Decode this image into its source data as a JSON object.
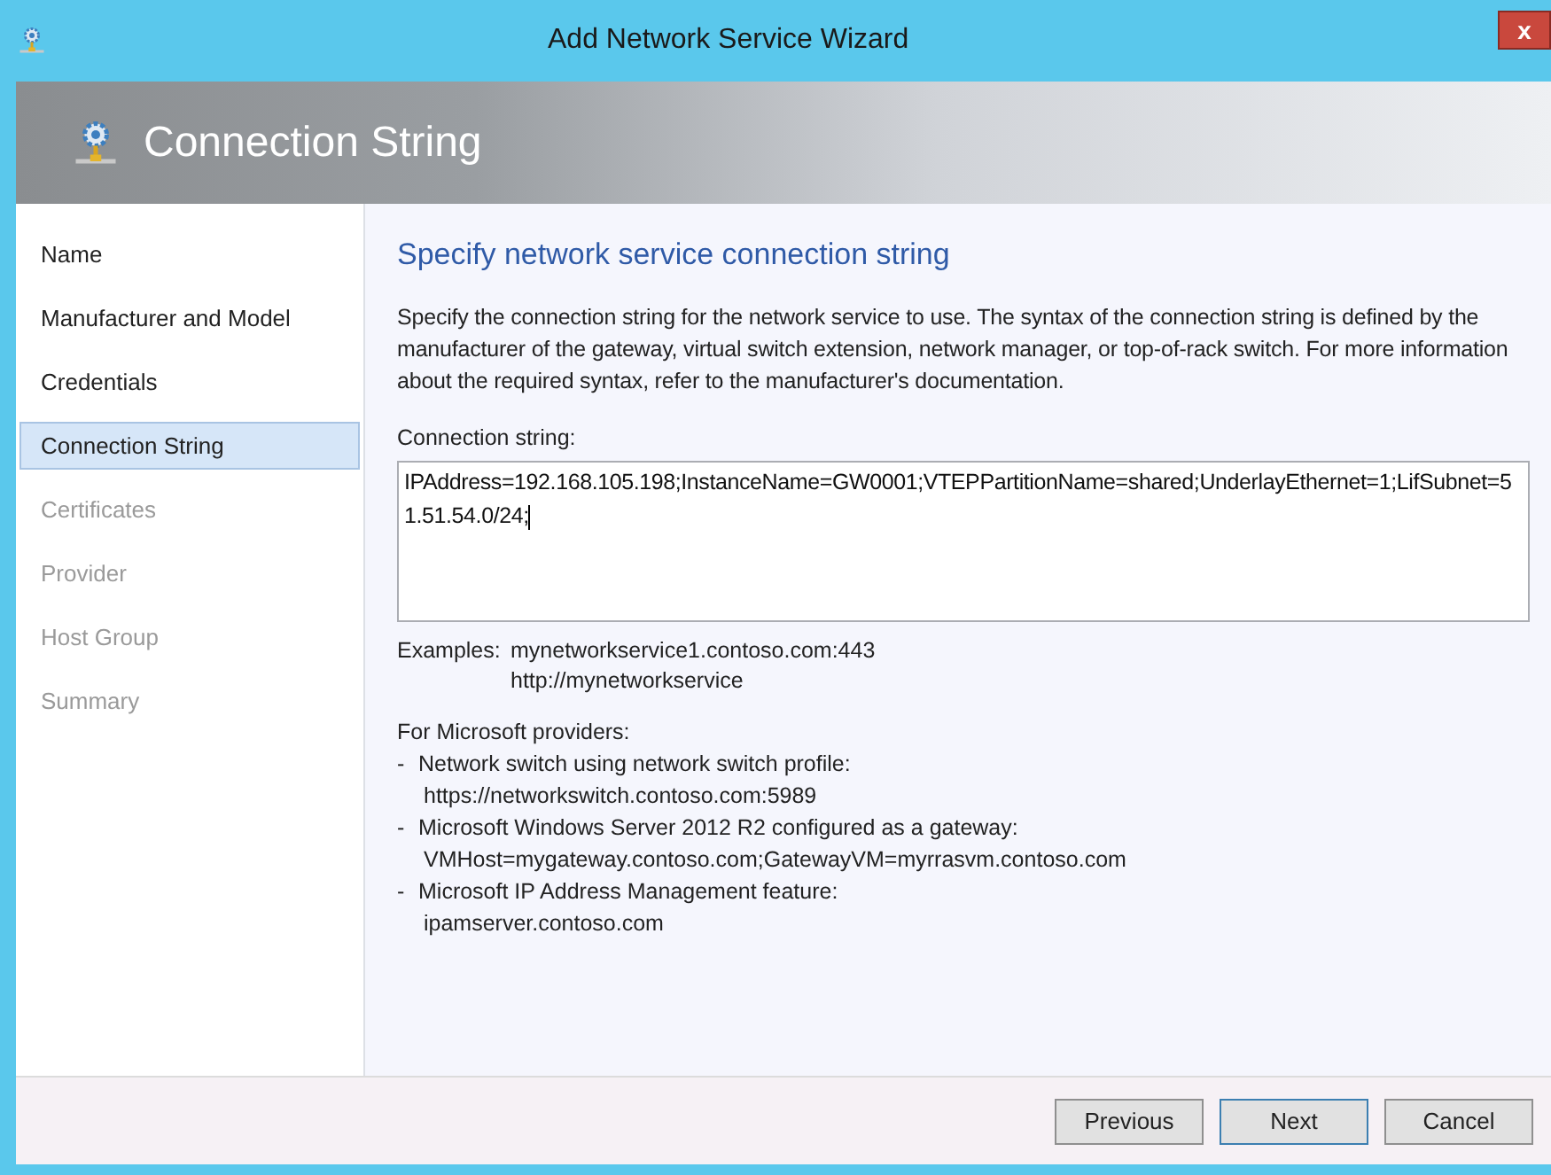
{
  "window": {
    "title": "Add Network Service Wizard",
    "close": "x"
  },
  "header": {
    "title": "Connection String"
  },
  "steps": [
    {
      "label": "Name",
      "selected": false,
      "disabled": false
    },
    {
      "label": "Manufacturer and Model",
      "selected": false,
      "disabled": false
    },
    {
      "label": "Credentials",
      "selected": false,
      "disabled": false
    },
    {
      "label": "Connection String",
      "selected": true,
      "disabled": false
    },
    {
      "label": "Certificates",
      "selected": false,
      "disabled": true
    },
    {
      "label": "Provider",
      "selected": false,
      "disabled": true
    },
    {
      "label": "Host Group",
      "selected": false,
      "disabled": true
    },
    {
      "label": "Summary",
      "selected": false,
      "disabled": true
    }
  ],
  "content": {
    "heading": "Specify network service connection string",
    "description": "Specify the connection string for the network service to use. The syntax of the connection string is defined by the manufacturer of the gateway, virtual switch extension, network manager, or top-of-rack switch. For more information about the required syntax, refer to the manufacturer's documentation.",
    "field_label": "Connection string:",
    "field_value": "IPAddress=192.168.105.198;InstanceName=GW0001;VTEPPartitionName=shared;UnderlayEthernet=1;LifSubnet=51.51.54.0/24;",
    "examples_label": "Examples:",
    "examples": [
      "mynetworkservice1.contoso.com:443",
      "http://mynetworkservice"
    ],
    "providers_title": "For Microsoft providers:",
    "providers": [
      {
        "bullet": "-",
        "label": "Network switch using network switch profile:",
        "value": "https://networkswitch.contoso.com:5989"
      },
      {
        "bullet": "-",
        "label": "Microsoft Windows Server 2012 R2 configured as a gateway:",
        "value": "VMHost=mygateway.contoso.com;GatewayVM=myrrasvm.contoso.com"
      },
      {
        "bullet": "-",
        "label": "Microsoft IP Address Management feature:",
        "value": "ipamserver.contoso.com"
      }
    ]
  },
  "buttons": [
    {
      "label": "Previous",
      "focused": false
    },
    {
      "label": "Next",
      "focused": true
    },
    {
      "label": "Cancel",
      "focused": false
    }
  ]
}
